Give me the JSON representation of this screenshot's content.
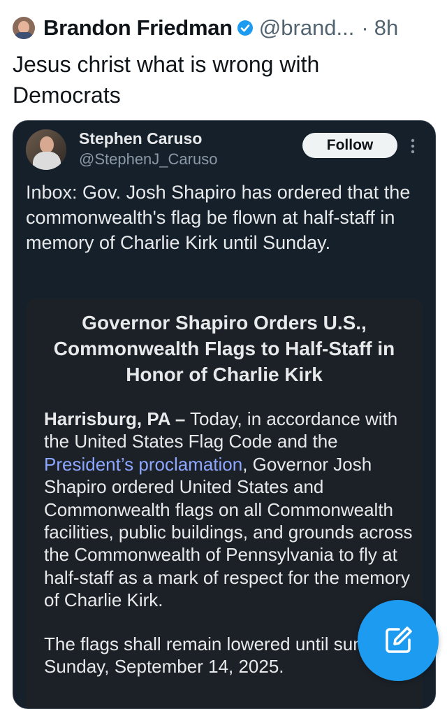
{
  "post": {
    "author_name": "Brandon Friedman",
    "author_handle": "@brand...",
    "separator": "·",
    "time": "8h",
    "text": "Jesus christ what is wrong with Democrats"
  },
  "quoted": {
    "author_name": "Stephen Caruso",
    "author_handle": "@StephenJ_Caruso",
    "follow_label": "Follow",
    "text": "Inbox: Gov. Josh Shapiro has ordered that the commonwealth's flag be flown at half-staff in memory of Charlie Kirk until Sunday.",
    "press_release": {
      "title": "Governor Shapiro Orders U.S., Commonwealth Flags to Half-Staff in Honor of Charlie Kirk",
      "dateline": "Harrisburg, PA –",
      "body_before_link": " Today, in accordance with the United States Flag Code and the ",
      "link_text": "President’s proclamation",
      "body_after_link": ", Governor Josh Shapiro ordered United States and Commonwealth flags on all Commonwealth facilities, public buildings, and grounds across the Commonwealth of Pennsylvania to fly at half-staff as a mark of respect for the memory of Charlie Kirk.",
      "second_paragraph": "The flags shall remain lowered until sunset on Sunday, September 14, 2025."
    }
  },
  "icons": {
    "verified": "verified-badge-icon",
    "more": "more-vertical-icon",
    "compose": "compose-icon"
  },
  "colors": {
    "verified": "#1d9bf0",
    "card_bg": "#15202b",
    "link": "#8da6ff",
    "fab": "#1d9bf0"
  }
}
